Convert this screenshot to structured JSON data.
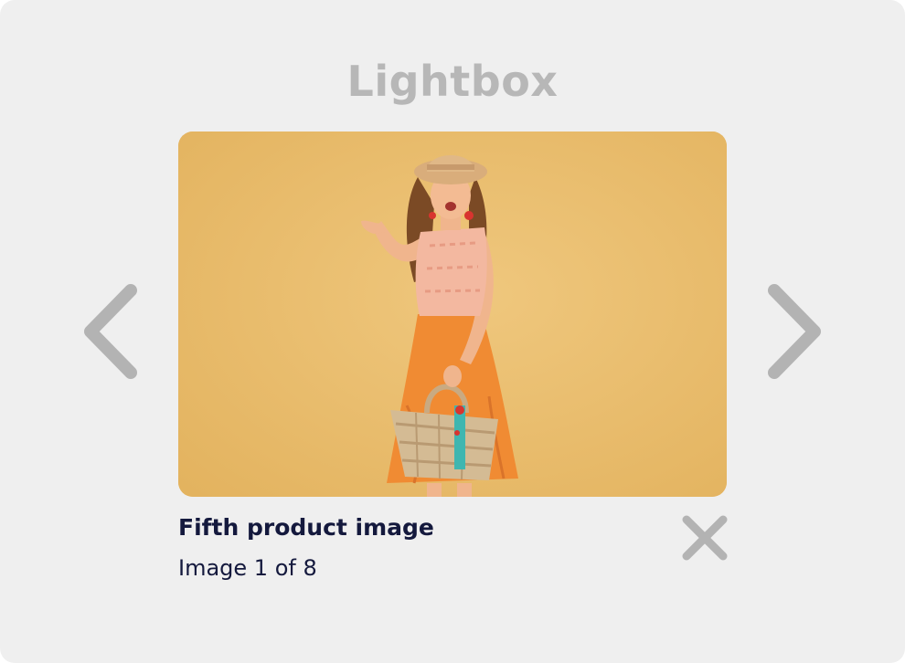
{
  "lightbox": {
    "title": "Lightbox",
    "image": {
      "alt": "Fifth product image",
      "subject": "woman in straw hat holding woven basket",
      "background_color": "#e9b96a"
    },
    "caption": {
      "title": "Fifth product image",
      "counter": "Image 1 of 8"
    },
    "controls": {
      "prev_icon": "chevron-left-icon",
      "next_icon": "chevron-right-icon",
      "close_icon": "close-icon",
      "icon_color": "#b3b3b3"
    },
    "pagination": {
      "current": 1,
      "total": 8
    }
  }
}
